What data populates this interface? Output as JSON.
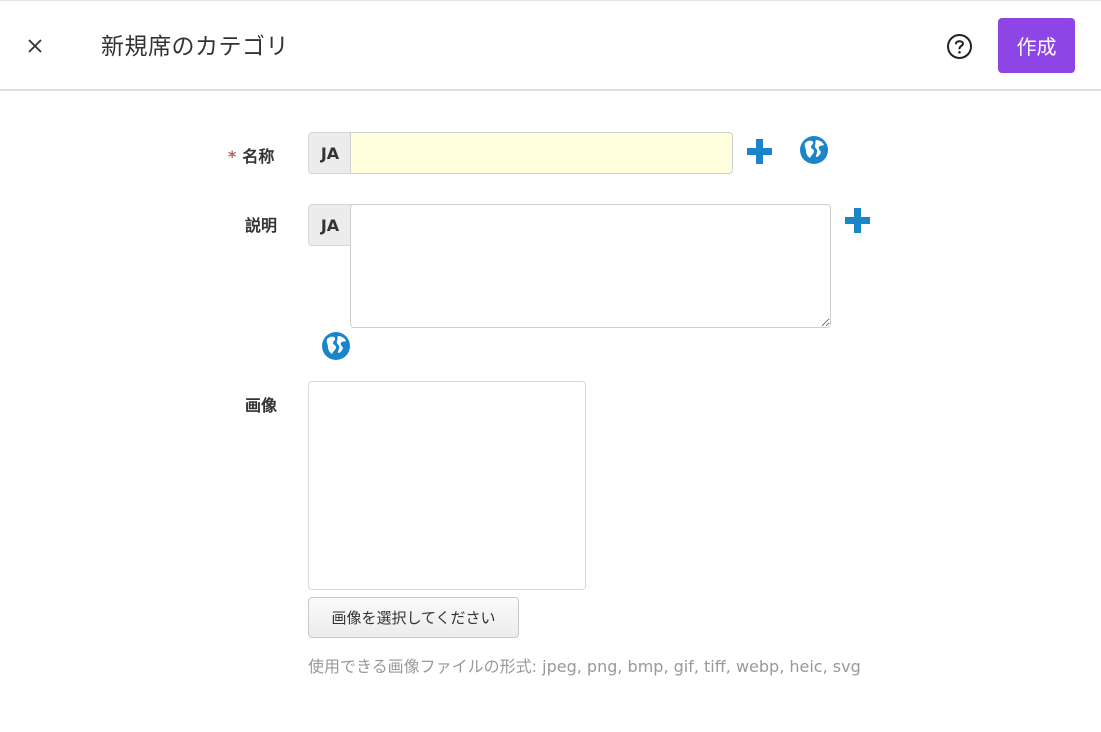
{
  "header": {
    "title": "新規席のカテゴリ",
    "create_label": "作成",
    "close_icon": "close-icon",
    "help_icon": "help-icon"
  },
  "form": {
    "name": {
      "required_mark": "*",
      "label": "名称",
      "lang": "JA",
      "value": "",
      "add_icon": "plus-icon",
      "translate_icon": "globe-icon"
    },
    "description": {
      "label": "説明",
      "lang": "JA",
      "value": "",
      "add_icon": "plus-icon",
      "translate_icon": "globe-icon"
    },
    "image": {
      "label": "画像",
      "select_button_label": "画像を選択してください",
      "formats_hint": "使用できる画像ファイルの形式: jpeg, png, bmp, gif, tiff, webp, heic, svg"
    }
  },
  "colors": {
    "accent": "#8e45e5",
    "icon_blue": "#1a85c8",
    "required": "#b0645c",
    "input_highlight": "#ffffdd"
  }
}
